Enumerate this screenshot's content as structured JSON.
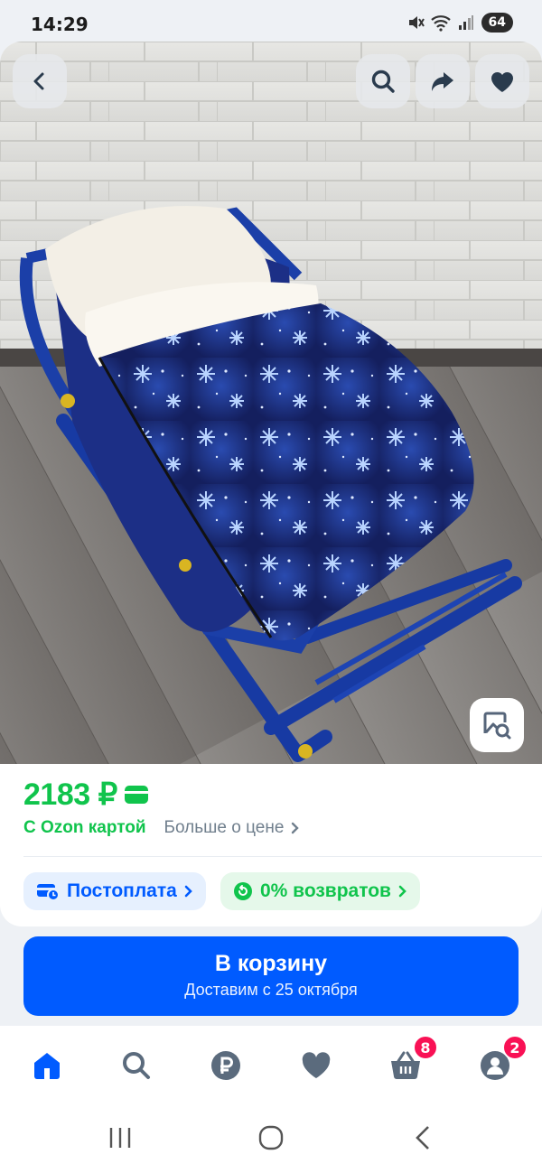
{
  "status_bar": {
    "time": "14:29",
    "battery": "64",
    "icons": [
      "mute-icon",
      "wifi-icon",
      "signal-icon",
      "battery-icon"
    ]
  },
  "product": {
    "image_alt": "Конверт на санки",
    "price": "2183 ₽",
    "ozon_card_label": "С Ozon картой",
    "more_price_label": "Больше о цене"
  },
  "chips": {
    "postpay": "Постоплата",
    "returns": "0% возвратов"
  },
  "cart": {
    "title": "В корзину",
    "subtitle": "Доставим с 25 октября"
  },
  "bottom_nav": {
    "items": [
      {
        "name": "home",
        "icon": "home-icon"
      },
      {
        "name": "search",
        "icon": "search-icon"
      },
      {
        "name": "payments",
        "icon": "ruble-icon"
      },
      {
        "name": "favorites",
        "icon": "heart-icon"
      },
      {
        "name": "cart",
        "icon": "basket-icon",
        "badge": "8"
      },
      {
        "name": "profile",
        "icon": "profile-icon",
        "badge": "2"
      }
    ]
  },
  "colors": {
    "accent": "#005bff",
    "price_green": "#10c44c",
    "badge_pink": "#f91155",
    "nav_active": "#005bff",
    "nav_inactive": "#5b6b7d"
  }
}
